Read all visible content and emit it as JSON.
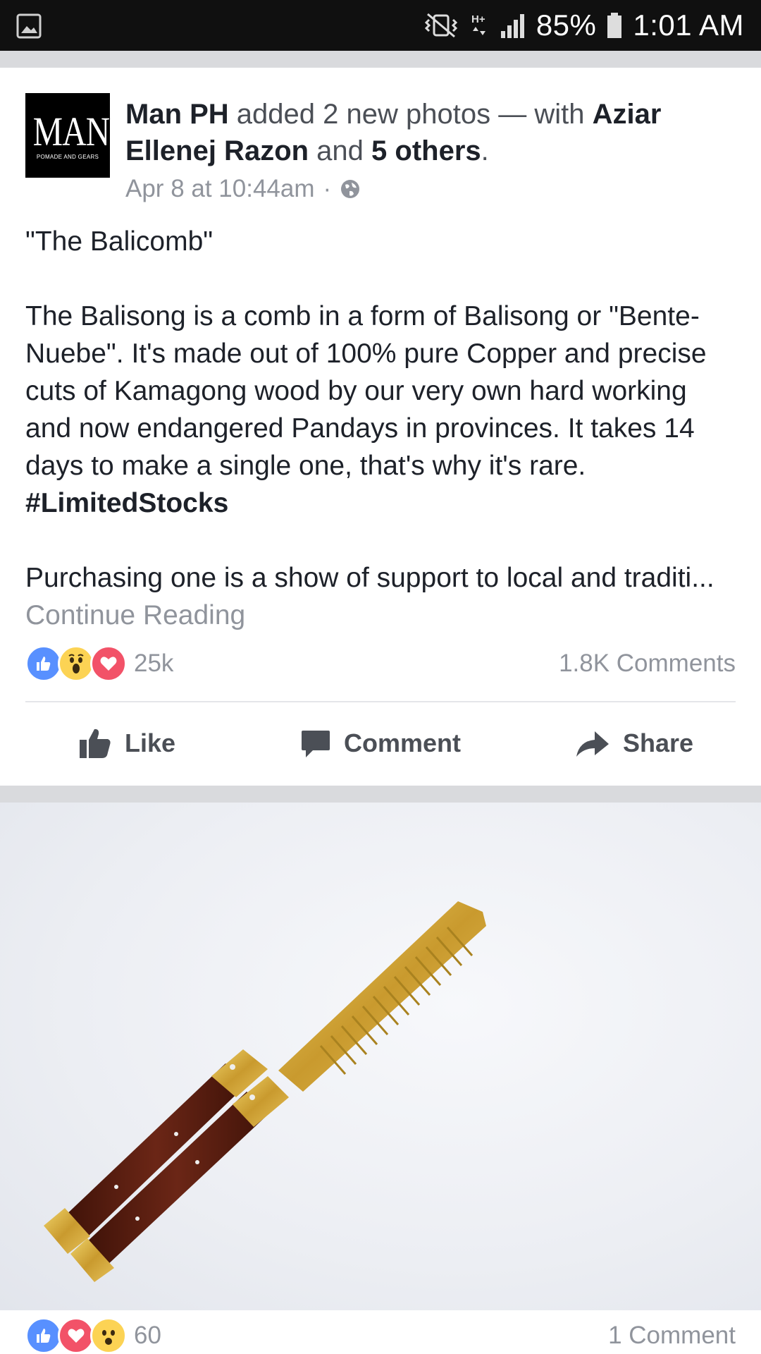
{
  "status_bar": {
    "battery": "85%",
    "time": "1:01 AM",
    "network": "H+"
  },
  "post": {
    "page_logo": {
      "big": "MAN",
      "small": "POMADE AND GEARS"
    },
    "author": "Man PH",
    "action_text": " added 2 new photos — with ",
    "tagged_name": "Aziar Ellenej Razon",
    "and_text": " and ",
    "others": "5 others",
    "end_punct": ".",
    "timestamp": "Apr 8 at 10:44am",
    "dot": "·",
    "title_line": "\"The Balicomb\"",
    "paragraph": "The Balisong is a comb in a form of Balisong or \"Bente-Nuebe\". It's made out of 100% pure Copper and precise cuts of Kamagong wood by our very own hard working and now endangered Pandays in provinces. It takes 14 days to make a single one, that's why it's rare. ",
    "hashtag": "#LimitedStocks",
    "paragraph2": "Purchasing one is a show of support to local and traditi... ",
    "continue_reading": "Continue Reading",
    "reaction_count": "25k",
    "comments_count": "1.8K Comments",
    "actions": {
      "like": "Like",
      "comment": "Comment",
      "share": "Share"
    }
  },
  "photo_post": {
    "reaction_count": "60",
    "comments_count": "1 Comment"
  },
  "colors": {
    "like_blue": "#5890ff",
    "love_red": "#f25268",
    "wow_yellow": "#fcd354",
    "comb_brass": "#d9b44a",
    "wood": "#5a1e14"
  }
}
